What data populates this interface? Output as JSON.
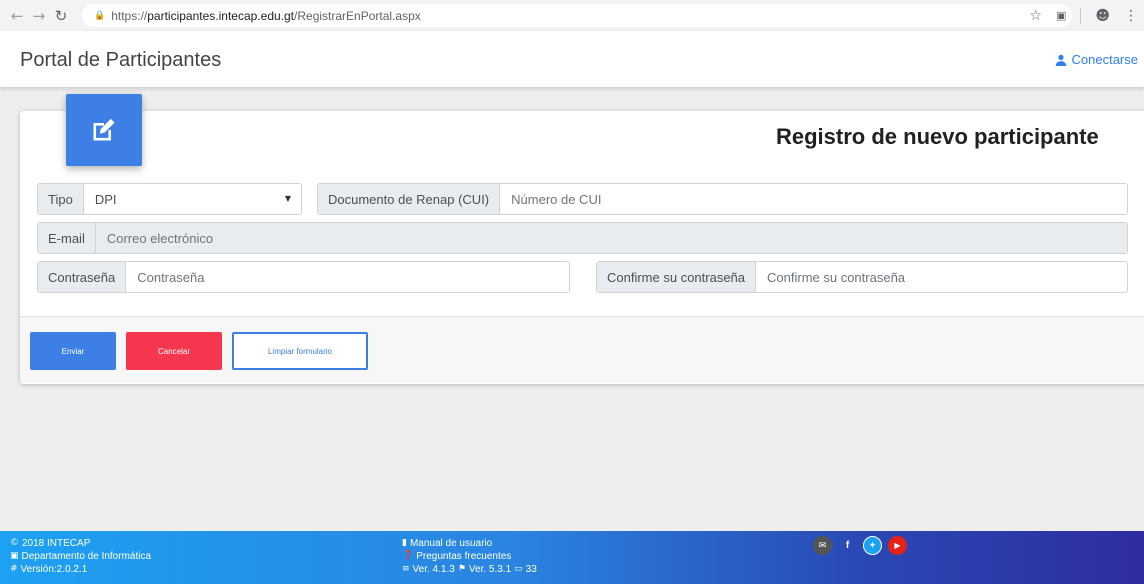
{
  "browser": {
    "url_scheme": "https://",
    "url_host": "participantes.intecap.edu.gt",
    "url_path": "/RegistrarEnPortal.aspx"
  },
  "navbar": {
    "brand": "Portal de Participantes",
    "connect_label": "Conectarse"
  },
  "form": {
    "title": "Registro de nuevo participante",
    "tipo_label": "Tipo",
    "tipo_value": "DPI",
    "cui_label": "Documento de Renap (CUI)",
    "cui_placeholder": "Número de CUI",
    "email_label": "E-mail",
    "email_placeholder": "Correo electrónico",
    "password_label": "Contraseña",
    "password_placeholder": "Contraseña",
    "confirm_label": "Confirme su contraseña",
    "confirm_placeholder": "Confirme su contraseña"
  },
  "buttons": {
    "send": "Enviar",
    "cancel": "Cancelar",
    "clear": "Limpiar formulario"
  },
  "footer": {
    "copyright": "2018 INTECAP",
    "department": "Departamento de Informática",
    "version": "Versión:2.0.2.1",
    "manual": "Manual de usuario",
    "faq": "Preguntas frecuentes",
    "ver_a": "Ver. 4.1.3",
    "ver_b": "Ver. 5.3.1",
    "count": "33"
  },
  "colors": {
    "primary": "#3d7fe5",
    "danger": "#f5364f",
    "link": "#2f80ed"
  },
  "icons": [
    "edit-icon",
    "user-icon",
    "copyright-icon",
    "laptop-icon",
    "hash-icon",
    "book-icon",
    "question-icon",
    "css3-icon",
    "flag-icon",
    "comment-icon",
    "mail-icon",
    "facebook-icon",
    "twitter-icon",
    "youtube-icon"
  ]
}
